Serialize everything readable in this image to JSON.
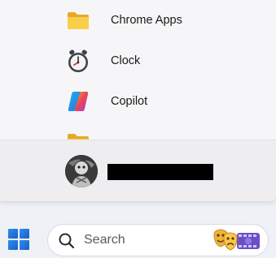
{
  "start_menu": {
    "apps": [
      {
        "label": "Chrome Apps",
        "icon": "folder-icon"
      },
      {
        "label": "Clock",
        "icon": "clock-icon"
      },
      {
        "label": "Copilot",
        "icon": "copilot-icon"
      },
      {
        "label": "",
        "icon": "folder-icon"
      }
    ],
    "user": {
      "avatar_icon": "user-avatar",
      "name_redacted": true
    }
  },
  "taskbar": {
    "start_icon": "windows-logo-icon",
    "search": {
      "placeholder": "Search",
      "highlight_icon": "theater-masks-film-icon"
    }
  },
  "colors": {
    "windows_blue": "#1f6fd6",
    "folder_yellow": "#f7c543",
    "panel_bg": "#f6f6f8"
  }
}
